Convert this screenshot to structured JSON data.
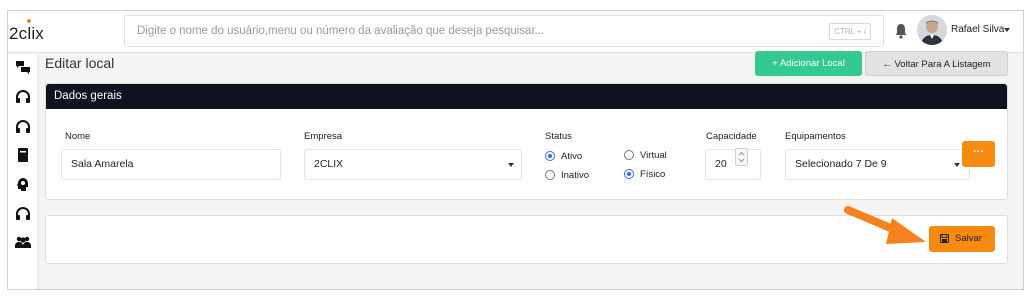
{
  "app": {
    "logo": "2clix",
    "brand_color": "#f5821f"
  },
  "search": {
    "placeholder": "Digite o nome do usuário,menu ou número da avaliação que deseja pesquisar...",
    "shortcut": "CTRL + /"
  },
  "user": {
    "name": "Rafael Silva"
  },
  "sidebar": {
    "icons": [
      "chat-bubbles-icon",
      "headset-icon",
      "headset-icon",
      "book-icon",
      "brain-head-icon",
      "headset-icon",
      "users-group-icon"
    ]
  },
  "page": {
    "title": "Editar local",
    "add_button": "Adicionar Local",
    "back_button": "Voltar Para A Listagem"
  },
  "form": {
    "section_title": "Dados gerais",
    "nome": {
      "label": "Nome",
      "value": "Sala Amarela"
    },
    "empresa": {
      "label": "Empresa",
      "value": "2CLIX"
    },
    "status": {
      "label": "Status",
      "options": [
        "Ativo",
        "Inativo"
      ],
      "selected": "Ativo"
    },
    "tipo": {
      "options": [
        "Virtual",
        "Físico"
      ],
      "selected": "Físico"
    },
    "capacidade": {
      "label": "Capacidade",
      "value": "20"
    },
    "equipamentos": {
      "label": "Equipamentos",
      "value": "Selecionado 7 De 9",
      "more_label": "···"
    }
  },
  "actions": {
    "save": "Salvar"
  },
  "colors": {
    "green": "#34c98e",
    "orange": "#f88a10",
    "header_dark": "#0e1320",
    "radio_blue": "#2f6fe4"
  }
}
